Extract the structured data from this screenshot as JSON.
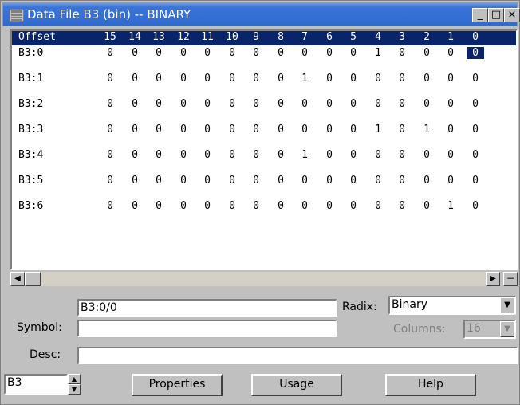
{
  "window": {
    "title": "Data File B3 (bin)  --  BINARY",
    "min_label": "_",
    "max_label": "□",
    "close_label": "×"
  },
  "grid": {
    "offset_label": "Offset",
    "bit_labels": [
      "15",
      "14",
      "13",
      "12",
      "11",
      "10",
      "9",
      "8",
      "7",
      "6",
      "5",
      "4",
      "3",
      "2",
      "1",
      "0"
    ],
    "rows": [
      {
        "address": "B3:0",
        "bits": [
          "0",
          "0",
          "0",
          "0",
          "0",
          "0",
          "0",
          "0",
          "0",
          "0",
          "0",
          "1",
          "0",
          "0",
          "0",
          "0"
        ]
      },
      {
        "address": "B3:1",
        "bits": [
          "0",
          "0",
          "0",
          "0",
          "0",
          "0",
          "0",
          "0",
          "1",
          "0",
          "0",
          "0",
          "0",
          "0",
          "0",
          "0"
        ]
      },
      {
        "address": "B3:2",
        "bits": [
          "0",
          "0",
          "0",
          "0",
          "0",
          "0",
          "0",
          "0",
          "0",
          "0",
          "0",
          "0",
          "0",
          "0",
          "0",
          "0"
        ]
      },
      {
        "address": "B3:3",
        "bits": [
          "0",
          "0",
          "0",
          "0",
          "0",
          "0",
          "0",
          "0",
          "0",
          "0",
          "0",
          "1",
          "0",
          "1",
          "0",
          "0"
        ]
      },
      {
        "address": "B3:4",
        "bits": [
          "0",
          "0",
          "0",
          "0",
          "0",
          "0",
          "0",
          "0",
          "1",
          "0",
          "0",
          "0",
          "0",
          "0",
          "0",
          "0"
        ]
      },
      {
        "address": "B3:5",
        "bits": [
          "0",
          "0",
          "0",
          "0",
          "0",
          "0",
          "0",
          "0",
          "0",
          "0",
          "0",
          "0",
          "0",
          "0",
          "0",
          "0"
        ]
      },
      {
        "address": "B3:6",
        "bits": [
          "0",
          "0",
          "0",
          "0",
          "0",
          "0",
          "0",
          "0",
          "0",
          "0",
          "0",
          "0",
          "0",
          "0",
          "1",
          "0"
        ]
      }
    ]
  },
  "scroll": {
    "left_arrow": "◀",
    "right_arrow": "▶",
    "split": "−"
  },
  "form": {
    "address_value": "B3:0/0",
    "radix_label": "Radix:",
    "radix_value": "Binary",
    "symbol_label": "Symbol:",
    "symbol_value": "",
    "columns_label": "Columns:",
    "columns_value": "16",
    "desc_label": "Desc:",
    "desc_value": "",
    "file_value": "B3",
    "dropdown_arrow": "▼",
    "spin_up": "▲",
    "spin_down": "▼"
  },
  "buttons": {
    "properties": "Properties",
    "usage": "Usage",
    "help": "Help"
  }
}
